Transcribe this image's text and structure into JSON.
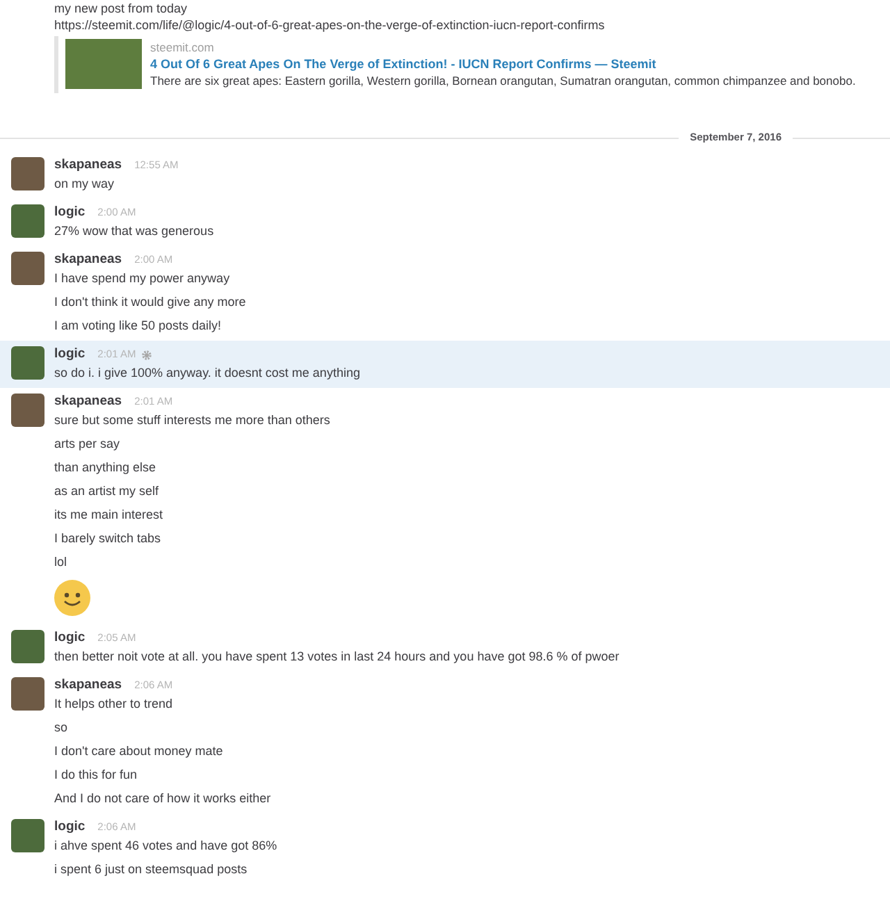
{
  "top_message": {
    "lines": [
      "my new post from today",
      "https://steemit.com/life/@logic/4-out-of-6-great-apes-on-the-verge-of-extinction-iucn-report-confirms"
    ],
    "attachment": {
      "site": "steemit.com",
      "title": "4 Out Of 6 Great Apes On The Verge of Extinction! - IUCN Report Confirms — Steemit",
      "description": "There are six great apes: Eastern gorilla, Western gorilla, Bornean orangutan, Sumatran orangutan, common chimpanzee and bonobo."
    }
  },
  "date_divider": "September 7, 2016",
  "groups": [
    {
      "author": "skapaneas",
      "color": "#6e5a45",
      "time": "12:55 AM",
      "highlighted": false,
      "items": [
        {
          "kind": "text",
          "text": "on my way"
        }
      ]
    },
    {
      "author": "logic",
      "color": "#4d6b3c",
      "time": "2:00 AM",
      "highlighted": false,
      "items": [
        {
          "kind": "text",
          "text": "27% wow that was generous"
        }
      ]
    },
    {
      "author": "skapaneas",
      "color": "#6e5a45",
      "time": "2:00 AM",
      "highlighted": false,
      "items": [
        {
          "kind": "text",
          "text": "I have spend my power anyway"
        },
        {
          "kind": "text",
          "text": "I don't think it would give any more"
        },
        {
          "kind": "text",
          "text": "I am voting like 50 posts daily!"
        }
      ]
    },
    {
      "author": "logic",
      "color": "#4d6b3c",
      "time": "2:01 AM",
      "highlighted": true,
      "items": [
        {
          "kind": "text",
          "text": "so do i. i give 100% anyway. it doesnt cost me anything"
        }
      ]
    },
    {
      "author": "skapaneas",
      "color": "#6e5a45",
      "time": "2:01 AM",
      "highlighted": false,
      "items": [
        {
          "kind": "text",
          "text": "sure but some stuff interests me more than others"
        },
        {
          "kind": "text",
          "text": "arts per say"
        },
        {
          "kind": "text",
          "text": "than anything else"
        },
        {
          "kind": "text",
          "text": "as an artist my self"
        },
        {
          "kind": "text",
          "text": "its me main interest"
        },
        {
          "kind": "text",
          "text": "I barely switch tabs"
        },
        {
          "kind": "text",
          "text": "lol"
        },
        {
          "kind": "emoji"
        }
      ]
    },
    {
      "author": "logic",
      "color": "#4d6b3c",
      "time": "2:05 AM",
      "highlighted": false,
      "items": [
        {
          "kind": "text",
          "text": "then better noit vote at all. you have spent 13 votes in last 24 hours and you have got 98.6 % of pwoer"
        }
      ]
    },
    {
      "author": "skapaneas",
      "color": "#6e5a45",
      "time": "2:06 AM",
      "highlighted": false,
      "items": [
        {
          "kind": "text",
          "text": "It helps other to trend"
        },
        {
          "kind": "text",
          "text": "so"
        },
        {
          "kind": "text",
          "text": "I don't care about money mate"
        },
        {
          "kind": "text",
          "text": "I do this for fun"
        },
        {
          "kind": "text",
          "text": "And I do not care of how it works either"
        }
      ]
    },
    {
      "author": "logic",
      "color": "#4d6b3c",
      "time": "2:06 AM",
      "highlighted": false,
      "items": [
        {
          "kind": "text",
          "text": "i ahve spent 46 votes and have got 86%"
        },
        {
          "kind": "text",
          "text": "i spent 6 just on steemsquad posts"
        }
      ]
    }
  ]
}
